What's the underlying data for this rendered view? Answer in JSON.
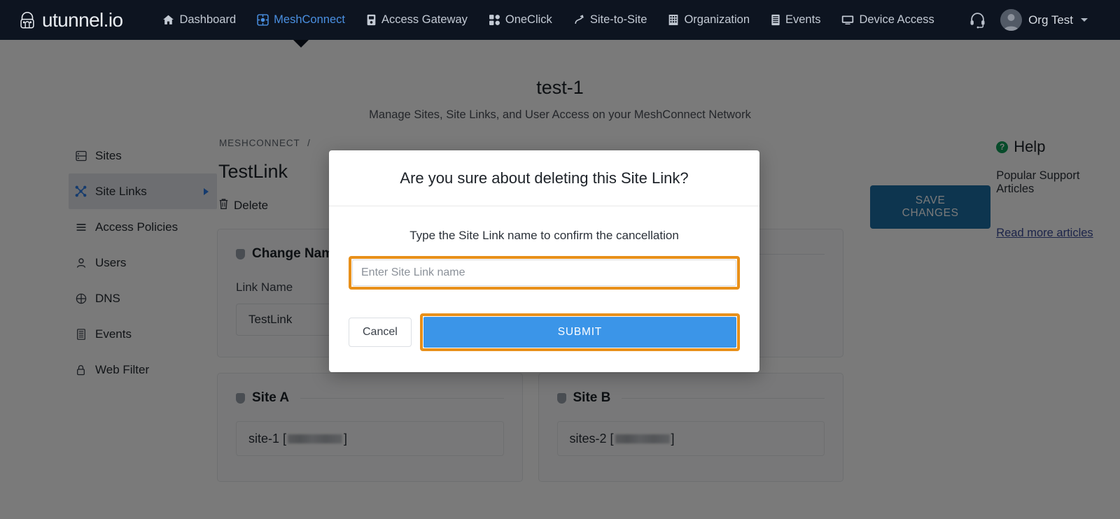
{
  "navbar": {
    "brand": "utunnel.io",
    "items": [
      {
        "label": "Dashboard",
        "icon": "home-icon",
        "active": false
      },
      {
        "label": "MeshConnect",
        "icon": "mesh-icon",
        "active": true
      },
      {
        "label": "Access Gateway",
        "icon": "server-icon",
        "active": false
      },
      {
        "label": "OneClick",
        "icon": "grid-icon",
        "active": false
      },
      {
        "label": "Site-to-Site",
        "icon": "link-path-icon",
        "active": false
      },
      {
        "label": "Organization",
        "icon": "building-icon",
        "active": false
      },
      {
        "label": "Events",
        "icon": "list-icon",
        "active": false
      },
      {
        "label": "Device Access",
        "icon": "monitor-icon",
        "active": false
      }
    ],
    "support_icon": "headset-icon",
    "user": "Org Test"
  },
  "page": {
    "title": "test-1",
    "subtitle": "Manage Sites, Site Links, and User Access on your MeshConnect Network"
  },
  "sidebar": {
    "items": [
      {
        "label": "Sites",
        "icon": "sites-icon",
        "active": false,
        "chevron": false
      },
      {
        "label": "Site Links",
        "icon": "site-links-icon",
        "active": true,
        "chevron": true
      },
      {
        "label": "Access Policies",
        "icon": "policies-icon",
        "active": false,
        "chevron": false
      },
      {
        "label": "Users",
        "icon": "user-icon",
        "active": false,
        "chevron": false
      },
      {
        "label": "DNS",
        "icon": "globe-icon",
        "active": false,
        "chevron": false
      },
      {
        "label": "Events",
        "icon": "events-icon",
        "active": false,
        "chevron": false
      },
      {
        "label": "Web Filter",
        "icon": "lock-icon",
        "active": false,
        "chevron": false
      }
    ]
  },
  "main": {
    "breadcrumb_root": "MESHCONNECT",
    "breadcrumb_sep": "/",
    "breadcrumb_current": "",
    "link_title": "TestLink",
    "delete_label": "Delete",
    "change_name_card": {
      "heading": "Change Name",
      "field_label": "Link Name",
      "field_value": "TestLink"
    },
    "site_a_card": {
      "heading": "Site A",
      "value": "site-1 [",
      "value_suffix": "]"
    },
    "site_b_card": {
      "heading": "Site B",
      "value": "sites-2 [",
      "value_suffix": "]"
    }
  },
  "right": {
    "save_label": "SAVE CHANGES",
    "help_title": "Help",
    "help_icon_glyph": "?",
    "help_subtitle": "Popular Support Articles",
    "read_more": "Read more articles"
  },
  "modal": {
    "title": "Are you sure about deleting this Site Link?",
    "message": "Type the Site Link name to confirm the cancellation",
    "input_value": "",
    "input_placeholder": "Enter Site Link name",
    "cancel_label": "Cancel",
    "submit_label": "SUBMIT"
  },
  "colors": {
    "navbar_bg": "#0d1420",
    "accent_blue": "#3b95e8",
    "highlight_orange": "#e8901a",
    "save_blue": "#1d6fa5",
    "help_green": "#0f9d58",
    "link_blue": "#3c4c9a"
  }
}
